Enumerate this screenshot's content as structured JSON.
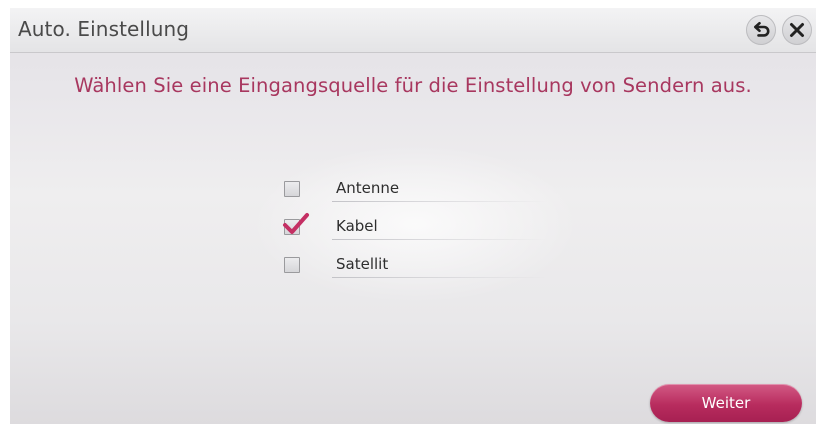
{
  "window": {
    "title": "Auto. Einstellung",
    "back_icon": "back-arrow-icon",
    "close_icon": "close-icon"
  },
  "prompt": "Wählen Sie eine Eingangsquelle für die Einstellung von Sendern aus.",
  "options": [
    {
      "label": "Antenne",
      "checked": false
    },
    {
      "label": "Kabel",
      "checked": true
    },
    {
      "label": "Satellit",
      "checked": false
    }
  ],
  "next_button": {
    "label": "Weiter"
  },
  "colors": {
    "accent": "#b82c5e",
    "prompt_text": "#a8375f",
    "checkmark": "#c42f63"
  }
}
